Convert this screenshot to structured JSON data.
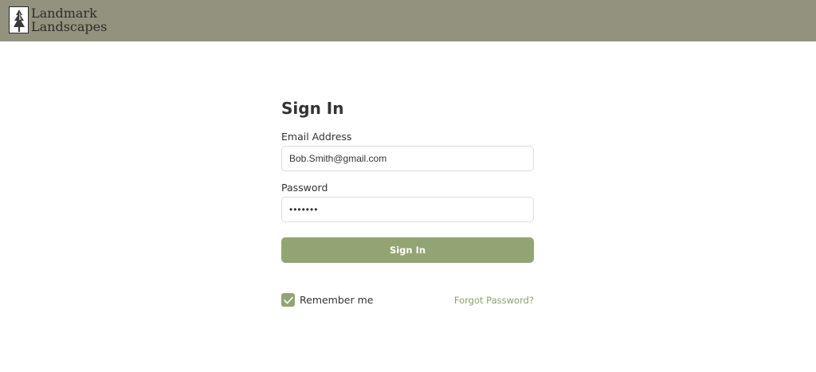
{
  "header": {
    "brand_line1": "Landmark",
    "brand_line2": "Landscapes",
    "logo_icon": "pine-tree-icon",
    "background_color": "#93927f"
  },
  "form": {
    "title": "Sign In",
    "email_label": "Email Address",
    "email_value": "Bob.Smith@gmail.com",
    "password_label": "Password",
    "password_value": "•••••••",
    "submit_label": "Sign In",
    "remember_label": "Remember me",
    "remember_checked": true,
    "forgot_label": "Forgot Password?",
    "accent_color": "#93a473"
  }
}
